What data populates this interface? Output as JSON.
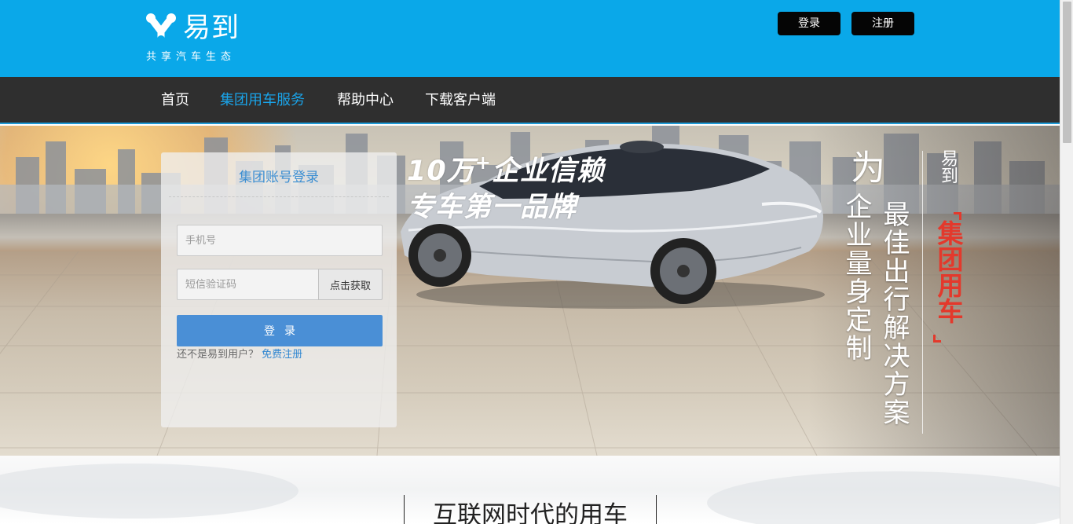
{
  "header": {
    "logo_name": "易到",
    "logo_tagline": "共享汽车生态",
    "login_label": "登录",
    "register_label": "注册"
  },
  "nav": {
    "items": [
      {
        "label": "首页",
        "active": false
      },
      {
        "label": "集团用车服务",
        "active": true
      },
      {
        "label": "帮助中心",
        "active": false
      },
      {
        "label": "下载客户端",
        "active": false
      }
    ]
  },
  "hero": {
    "headline_line1": "10万",
    "headline_plus": "+",
    "headline_line1_rest": "企业信赖",
    "headline_line2": "专车第一品牌",
    "slogan_wei": "为",
    "slogan_a": "企业量身定制",
    "slogan_b": "最佳出行解决方案",
    "brand": "易到",
    "service": "集团用车"
  },
  "login": {
    "title": "集团账号登录",
    "phone_placeholder": "手机号",
    "code_placeholder": "短信验证码",
    "code_button": "点击获取",
    "submit_label": "登录",
    "foot_text": "还不是易到用户？",
    "signup_link": "免费注册"
  },
  "section": {
    "title": "互联网时代的用车"
  },
  "colors": {
    "header_bg": "#0aa8e9",
    "nav_bg": "#2f2f2f",
    "nav_active": "#1aa3e8",
    "button_blue": "#4a8fd6",
    "accent_red": "#e3392c"
  }
}
